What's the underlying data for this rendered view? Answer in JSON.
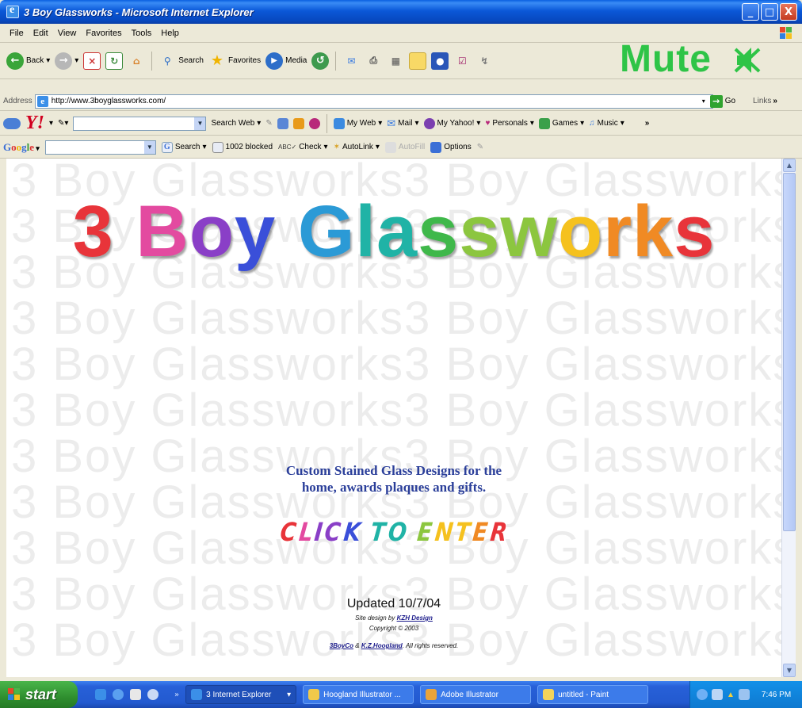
{
  "window": {
    "title": "3 Boy Glassworks - Microsoft Internet Explorer",
    "controls": {
      "minimize": "_",
      "maximize": "□",
      "close": "X"
    }
  },
  "menubar": {
    "items": [
      "File",
      "Edit",
      "View",
      "Favorites",
      "Tools",
      "Help"
    ]
  },
  "toolbar": {
    "back_label": "Back",
    "search_label": "Search",
    "favorites_label": "Favorites",
    "media_label": "Media",
    "overlay_text": "Mute",
    "overlay_color": "#2ec447"
  },
  "addressbar": {
    "label": "Address",
    "url": "http://www.3boyglassworks.com/",
    "go_label": "Go",
    "links_label": "Links"
  },
  "yahoo_toolbar": {
    "logo": "Y!",
    "search_value": "",
    "search_web_label": "Search Web",
    "my_web_label": "My Web",
    "mail_label": "Mail",
    "my_yahoo_label": "My Yahoo!",
    "personals_label": "Personals",
    "games_label": "Games",
    "music_label": "Music"
  },
  "google_toolbar": {
    "logo": "Google",
    "search_value": "",
    "search_label": "Search",
    "blocked_label": "1002 blocked",
    "check_label": "Check",
    "autolink_label": "AutoLink",
    "autofill_label": "AutoFill",
    "options_label": "Options"
  },
  "page": {
    "watermark_text": "3 Boy Glassworks",
    "logo_text": "3 Boy Glassworks",
    "tagline_line1": "Custom Stained Glass Designs for the",
    "tagline_line2": "home, awards plaques and gifts.",
    "enter_link": "CLICK TO ENTER",
    "updated": "Updated 10/7/04",
    "design_prefix": "Site design by",
    "design_link": "KZH Design",
    "copyright": "Copyright © 2003",
    "rights_link1": "3BoyCo",
    "rights_amp": "&",
    "rights_link2": "K.Z.Hoogland",
    "rights_suffix": ". All rights reserved.",
    "colors": {
      "tagline": "#2b3f9a",
      "logo_palette": [
        "#e8343a",
        "#e34aa0",
        "#8a3fc7",
        "#3a4fd9",
        "#2b9ad6",
        "#20b3a6",
        "#3fb84a",
        "#8cc63f",
        "#f5c11e",
        "#f08a24",
        "#e8343a"
      ]
    }
  },
  "taskbar": {
    "start_label": "start",
    "tasks": [
      {
        "label": "3 Internet Explorer"
      },
      {
        "label": "Hoogland Illustrator ..."
      },
      {
        "label": "Adobe Illustrator"
      },
      {
        "label": "untitled - Paint"
      }
    ],
    "clock": "7:46 PM"
  }
}
